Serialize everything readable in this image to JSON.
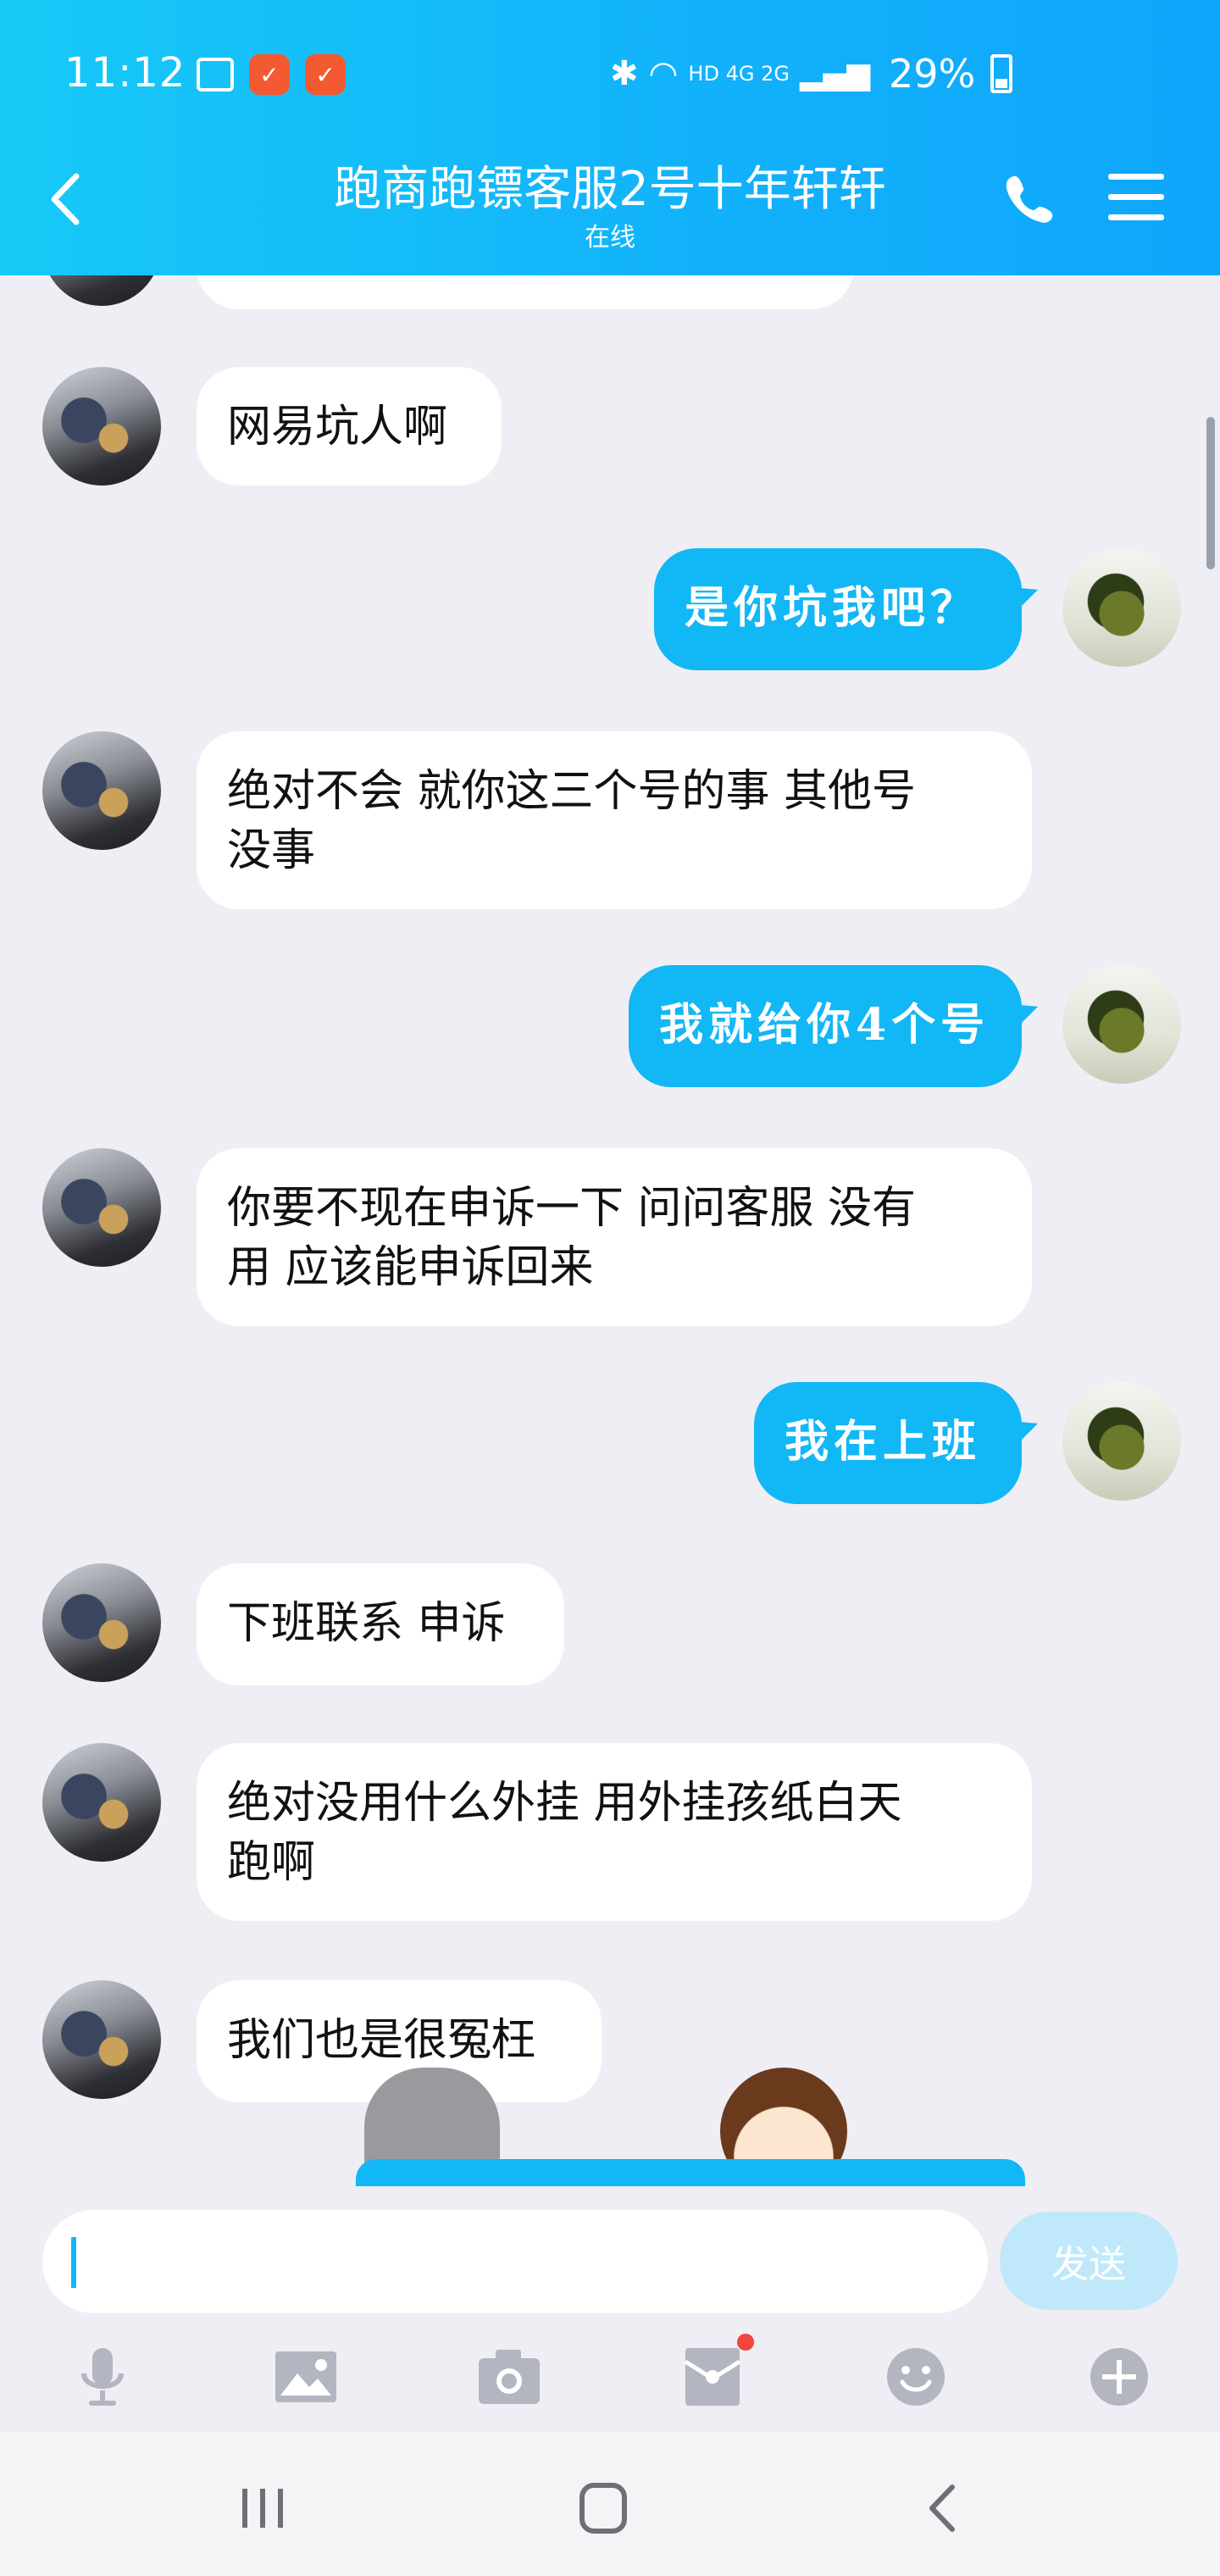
{
  "status": {
    "time": "11:12",
    "network": "HD 4G 2G",
    "battery": "29%"
  },
  "header": {
    "title": "跑商跑镖客服2号十年轩轩",
    "subtitle": "在线"
  },
  "messages": [
    {
      "sender": "them",
      "text": "网易坑人啊"
    },
    {
      "sender": "me",
      "text": "是你坑我吧？"
    },
    {
      "sender": "them",
      "line1": "绝对不会 就你这三个号的事 其他号",
      "line2": "没事"
    },
    {
      "sender": "me",
      "text": "我就给你4个号"
    },
    {
      "sender": "them",
      "line1": "你要不现在申诉一下  问问客服 没有",
      "line2": "用 应该能申诉回来"
    },
    {
      "sender": "me",
      "text": "我在上班"
    },
    {
      "sender": "them",
      "text": "下班联系 申诉"
    },
    {
      "sender": "them",
      "line1": "绝对没用什么外挂   用外挂孩纸白天",
      "line2": "跑啊"
    },
    {
      "sender": "them",
      "text": "我们也是很冤枉"
    }
  ],
  "composer": {
    "input_value": "",
    "send_label": "发送"
  },
  "colors": {
    "accent": "#12b7f5",
    "header_start": "#17c9f7",
    "background": "#eeeef4"
  },
  "icons": {
    "toolbar": [
      "microphone-icon",
      "image-icon",
      "camera-icon",
      "red-packet-icon",
      "emoji-icon",
      "plus-icon"
    ],
    "nav": [
      "recents-icon",
      "home-icon",
      "back-icon"
    ]
  }
}
